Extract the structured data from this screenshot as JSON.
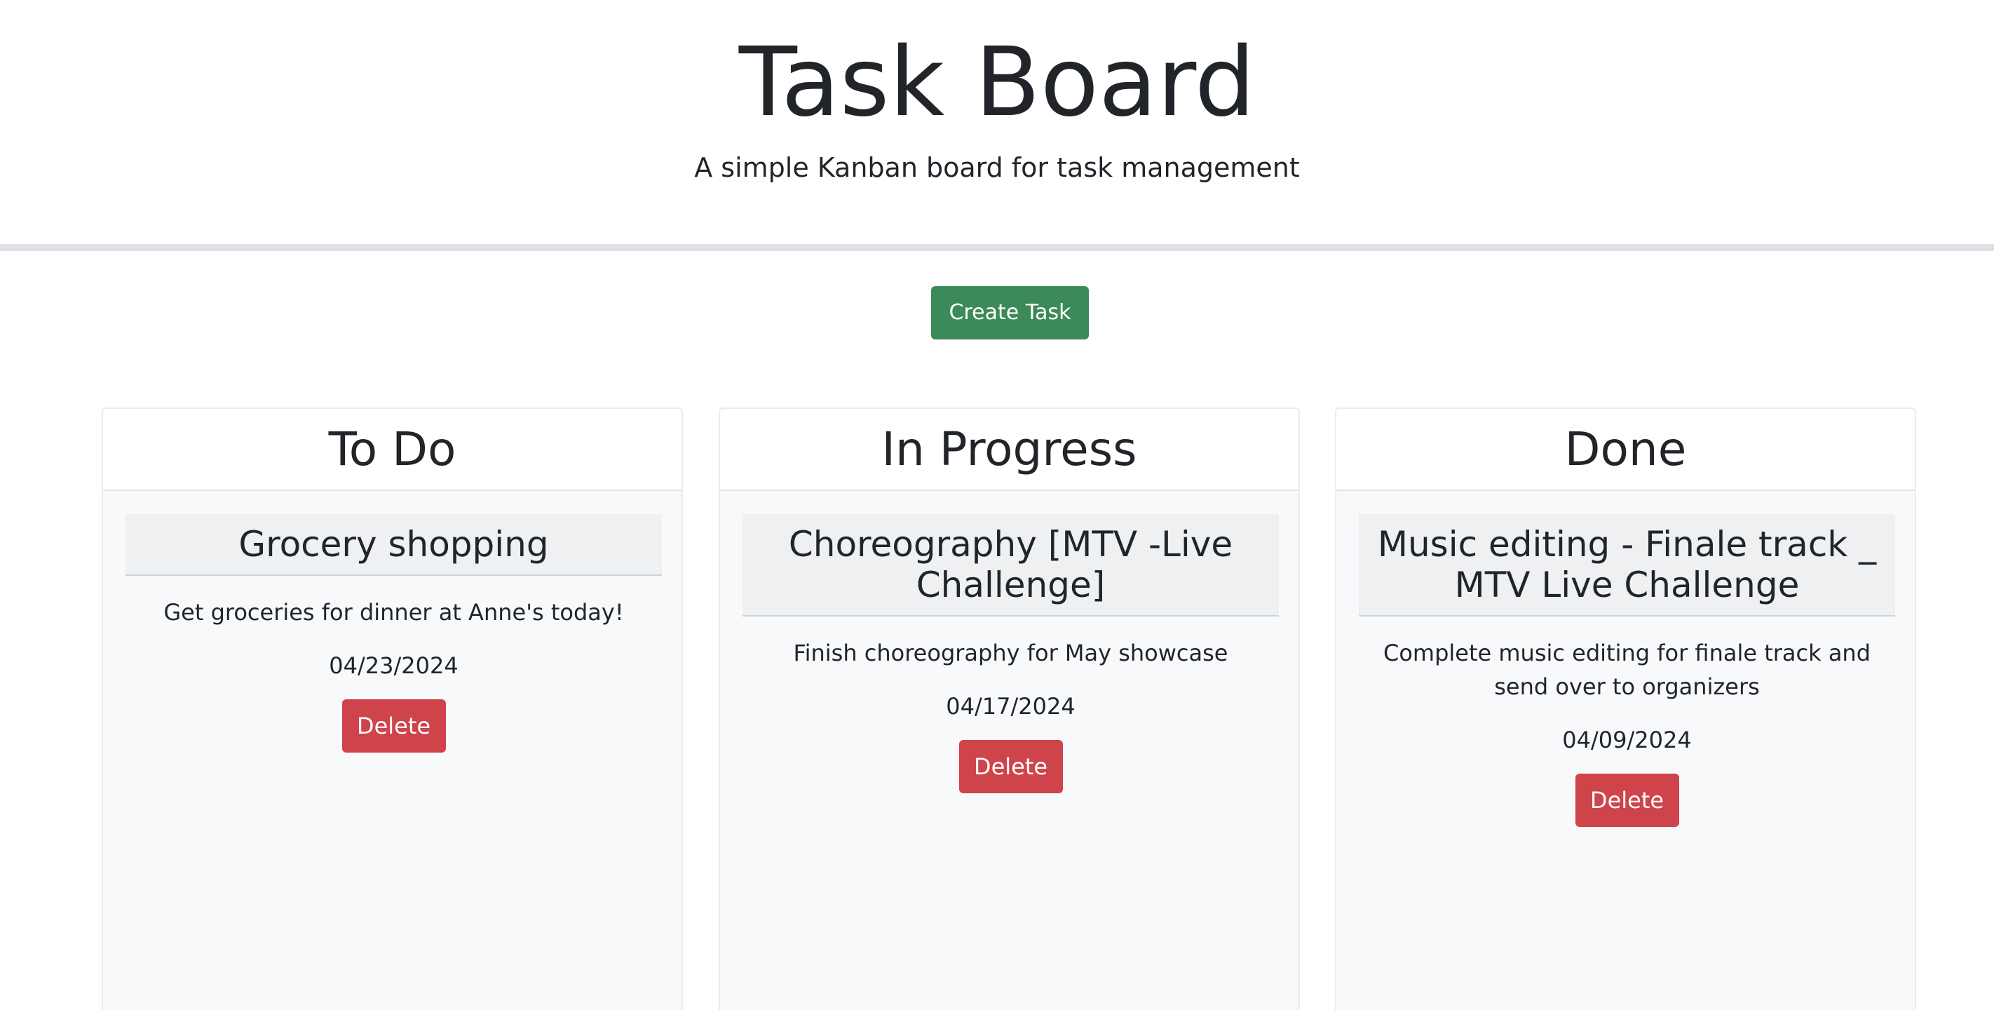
{
  "header": {
    "title": "Task Board",
    "subtitle": "A simple Kanban board for task management"
  },
  "toolbar": {
    "create_label": "Create Task"
  },
  "colors": {
    "create_button": "#3c8a57",
    "delete_button": "#cf434b",
    "column_bg": "#f8f9fa",
    "card_title_bg": "#eff0f2"
  },
  "columns": [
    {
      "title": "To Do",
      "cards": [
        {
          "title": "Grocery shopping",
          "description": "Get groceries for dinner at Anne's today!",
          "date": "04/23/2024",
          "delete_label": "Delete"
        }
      ]
    },
    {
      "title": "In Progress",
      "cards": [
        {
          "title": "Choreography [MTV -Live Challenge]",
          "description": "Finish choreography for May showcase",
          "date": "04/17/2024",
          "delete_label": "Delete"
        }
      ]
    },
    {
      "title": "Done",
      "cards": [
        {
          "title": "Music editing - Finale track _ MTV Live Challenge",
          "description": "Complete music editing for finale track and send over to organizers",
          "date": "04/09/2024",
          "delete_label": "Delete"
        }
      ]
    }
  ]
}
